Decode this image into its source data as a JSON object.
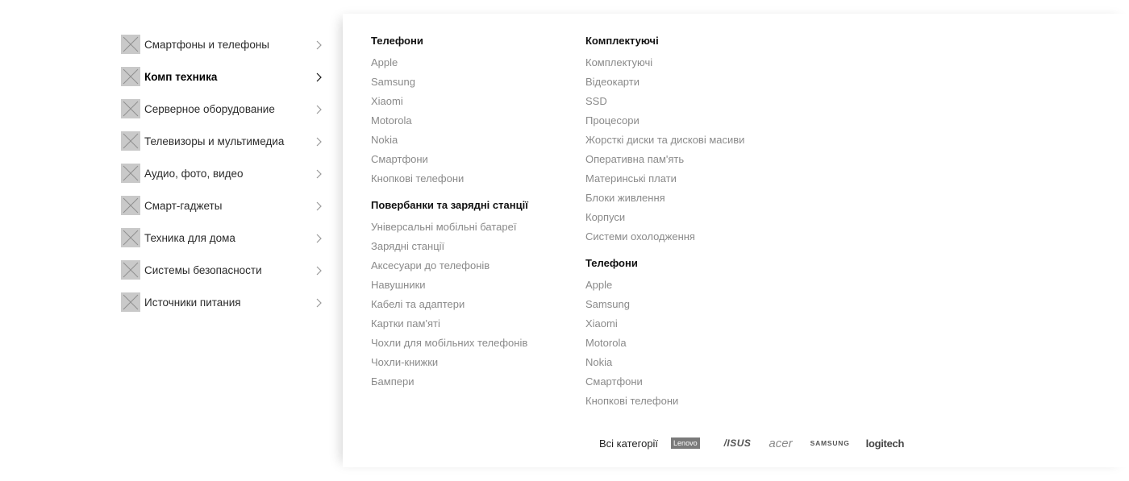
{
  "sidebar": {
    "items": [
      {
        "label": "Смартфоны и телефоны",
        "active": false
      },
      {
        "label": "Комп техника",
        "active": true
      },
      {
        "label": "Серверное оборудование",
        "active": false
      },
      {
        "label": "Телевизоры и мультимедиа",
        "active": false
      },
      {
        "label": "Аудио, фото, видео",
        "active": false
      },
      {
        "label": "Смарт-гаджеты",
        "active": false
      },
      {
        "label": "Техника для дома",
        "active": false
      },
      {
        "label": "Системы безопасности",
        "active": false
      },
      {
        "label": "Источники питания",
        "active": false
      }
    ],
    "icon": "image-placeholder-icon",
    "chevron_icon": "chevron-right-icon"
  },
  "panel": {
    "col1": {
      "group1": {
        "title": "Телефони",
        "links": [
          "Apple",
          "Samsung",
          "Xiaomi",
          "Motorola",
          "Nokia",
          "Смартфони",
          "Кнопкові телефони"
        ]
      },
      "group2": {
        "title": "Повербанки та зарядні станції",
        "links": [
          "Універсальні мобільні батареї",
          "Зарядні станції",
          "Аксесуари до телефонів",
          "Навушники",
          "Кабелі та адаптери",
          "Картки пам'яті",
          "Чохли для мобільних телефонів",
          "Чохли-книжки",
          "Бампери"
        ]
      }
    },
    "col2": {
      "group1": {
        "title": "Комплектуючі",
        "links": [
          "Комплектуючі",
          "Відеокарти",
          "SSD",
          "Процесори",
          "Жорсткі диски та дискові масиви",
          "Оперативна пам'ять",
          "Материнські плати",
          "Блоки живлення",
          "Корпуси",
          "Системи охолодження"
        ]
      },
      "group2": {
        "title": "Телефони",
        "links": [
          "Apple",
          "Samsung",
          "Xiaomi",
          "Motorola",
          "Nokia",
          "Смартфони",
          "Кнопкові телефони"
        ]
      }
    }
  },
  "brands": {
    "all_categories": "Всі категорії",
    "logos": [
      "Lenovo",
      "/ISUS",
      "acer",
      "SAMSUNG",
      "logitech"
    ]
  },
  "colors": {
    "text_primary": "#1a1a1a",
    "text_muted": "#8a8a8a",
    "placeholder": "#c9c9c9"
  }
}
